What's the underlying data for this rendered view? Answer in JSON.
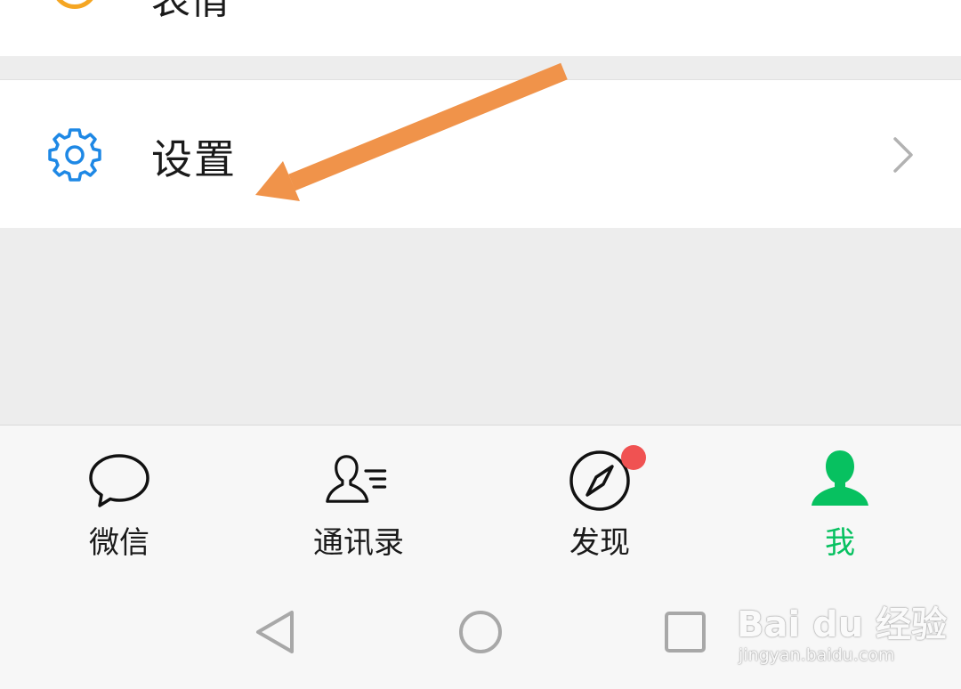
{
  "top_row": {
    "label": "表情"
  },
  "settings_row": {
    "label": "设置"
  },
  "bottom_nav": {
    "items": [
      {
        "label": "微信",
        "icon": "chat-bubble-icon",
        "active": false
      },
      {
        "label": "通讯录",
        "icon": "contacts-icon",
        "active": false
      },
      {
        "label": "发现",
        "icon": "compass-icon",
        "active": false,
        "badge": true
      },
      {
        "label": "我",
        "icon": "person-icon",
        "active": true
      }
    ]
  },
  "system_nav": {
    "buttons": [
      "back-icon",
      "home-icon",
      "recent-apps-icon"
    ]
  },
  "watermark": {
    "main": "Bai du 经验",
    "sub": "jingyan.baidu.com"
  },
  "colors": {
    "accent_green": "#07c160",
    "settings_icon_blue": "#1e88e5",
    "annotation_orange": "#f0934a",
    "badge_red": "#f05252",
    "background_gray": "#ededed"
  }
}
